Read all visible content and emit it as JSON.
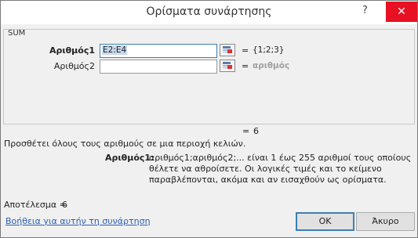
{
  "dialog": {
    "title": "Ορίσματα συνάρτησης",
    "help_glyph": "?",
    "close_glyph": "✕"
  },
  "function_group": {
    "name": "SUM",
    "args": [
      {
        "label": "Αριθμός1",
        "value": "E2:E4",
        "result": "{1;2;3}"
      },
      {
        "label": "Αριθμός2",
        "value": "",
        "result": "αριθμός"
      }
    ],
    "equals": "="
  },
  "formula_result": {
    "equals": "=",
    "value": "6"
  },
  "description": "Προσθέτει όλους τους αριθμούς σε μια περιοχή κελιών.",
  "arg_help": {
    "label": "Αριθμός1:",
    "text": "αριθμός1;αριθμός2;... είναι 1 έως 255 αριθμοί τους οποίους θέλετε να αθροίσετε. Οι λογικές τιμές και το κείμενο παραβλέπονται, ακόμα και αν εισαχθούν ως ορίσματα."
  },
  "result": {
    "label": "Αποτέλεσμα =",
    "value": "6"
  },
  "help_link": "Βοήθεια για αυτήν τη συνάρτηση",
  "buttons": {
    "ok": "OK",
    "cancel": "Άκυρο"
  }
}
